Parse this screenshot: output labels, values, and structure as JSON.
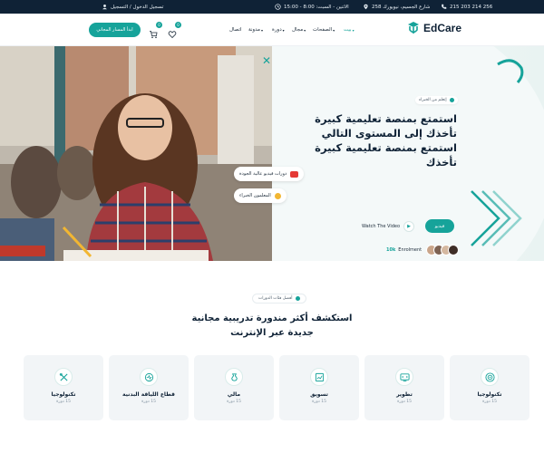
{
  "topbar": {
    "phone": "215 203 214 256",
    "address": "258 شارع الجسيم، نيويورك",
    "hours": "الاثنين - السبت: 8:00 - 15:00",
    "auth": "تسجيل الدخول / التسجيل"
  },
  "brand": {
    "name": "EdCare"
  },
  "nav": {
    "items": [
      {
        "label": "بيت",
        "active": true
      },
      {
        "label": "الصفحات"
      },
      {
        "label": "مجال"
      },
      {
        "label": "دورة"
      },
      {
        "label": "مدونة"
      },
      {
        "label": "اتصال"
      }
    ],
    "cart_count": "0",
    "wishlist_count": "0",
    "cta": "ابدأ المسار المجاني"
  },
  "hero": {
    "subtag": "إتعلم من الخبراء",
    "title": "استمتع بمنصة تعليمية كبيرة تأخذك إلى المستوى التالي استمتع بمنصة تعليمية كبيرة تأخذك",
    "primary_button": "فيديو",
    "watch_label": "Watch The Video",
    "enroll_count": "10k",
    "enroll_label": "Enrolment",
    "chip_video": "دورات فيديو عالية الجودة",
    "chip_teachers": "المعلمون الخبراء"
  },
  "courses": {
    "tag": "أفضل فئات الدورات",
    "title": "استكشف أكثر مندورة تدريبية مجانية جديدة عبر الإنترنت",
    "items": [
      {
        "title": "تكنولوجيا",
        "sub": "15 دورة",
        "icon": "target-icon"
      },
      {
        "title": "تطوير",
        "sub": "15 دورة",
        "icon": "dev-icon"
      },
      {
        "title": "تسويق",
        "sub": "15 دورة",
        "icon": "marketing-icon"
      },
      {
        "title": "مالي",
        "sub": "15 دورة",
        "icon": "finance-icon"
      },
      {
        "title": "قطاع اللياقة البدنية",
        "sub": "15 دورة",
        "icon": "fitness-icon"
      },
      {
        "title": "تكنولوجيا",
        "sub": "15 دورة",
        "icon": "tools-icon"
      }
    ]
  },
  "colors": {
    "accent": "#16a39a",
    "dark": "#0f2236",
    "card": "#f2f5f7"
  }
}
